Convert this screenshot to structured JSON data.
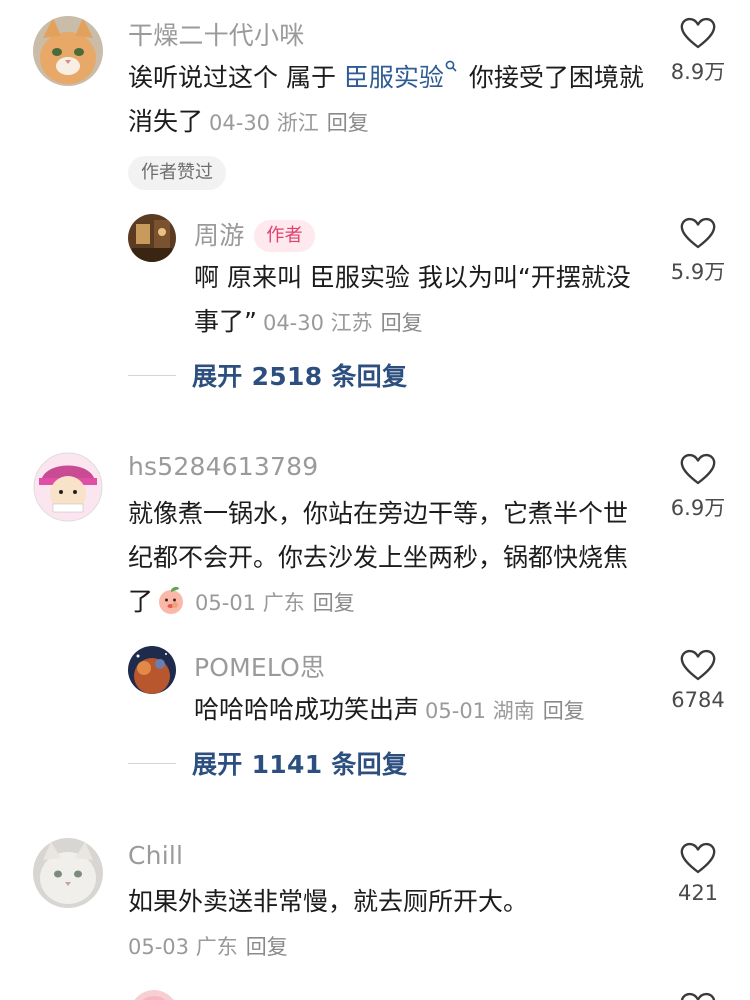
{
  "comments": [
    {
      "username": "干燥二十代小咪",
      "text_part1": "诶听说过这个 属于 ",
      "link_text": "臣服实验",
      "text_part2": " 你接受了困境就消失了",
      "date": "04-30",
      "location": "浙江",
      "reply_label": "回复",
      "likes": "8.9万",
      "author_liked": "作者赞过",
      "replies": [
        {
          "username": "周游",
          "author_tag": "作者",
          "text": "啊 原来叫 臣服实验 我以为叫“开摆就没事了”",
          "date": "04-30",
          "location": "江苏",
          "reply_label": "回复",
          "likes": "5.9万"
        }
      ],
      "expand_label": "展开 2518 条回复"
    },
    {
      "username": "hs5284613789",
      "text": "就像煮一锅水，你站在旁边干等，它煮半个世纪都不会开。你去沙发上坐两秒，锅都快烧焦了",
      "emoji": "peach-emoji",
      "date": "05-01",
      "location": "广东",
      "reply_label": "回复",
      "likes": "6.9万",
      "replies": [
        {
          "username": "POMELO思",
          "text": "哈哈哈哈成功笑出声",
          "date": "05-01",
          "location": "湖南",
          "reply_label": "回复",
          "likes": "6784"
        }
      ],
      "expand_label": "展开 1141 条回复"
    },
    {
      "username": "Chill",
      "text": "如果外卖送非常慢，就去厕所开大。",
      "date": "05-03",
      "location": "广东",
      "reply_label": "回复",
      "likes": "421"
    }
  ],
  "colors": {
    "link": "#2e5b94",
    "author_tag_bg": "#fde9ee",
    "author_tag_text": "#e33f6e",
    "username": "#9a9a9a"
  }
}
